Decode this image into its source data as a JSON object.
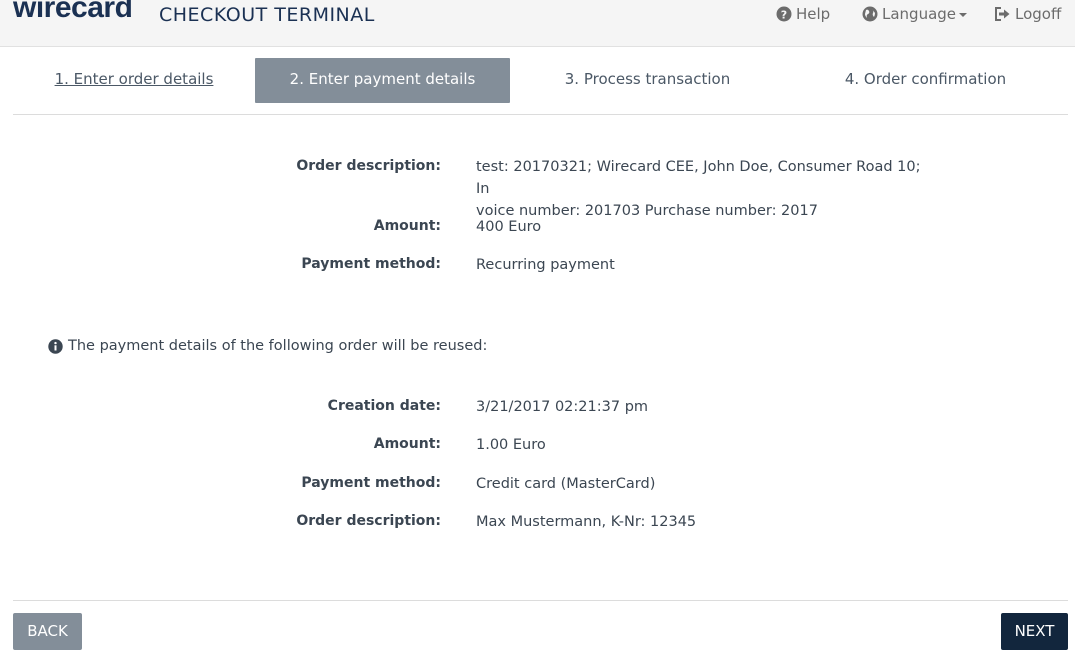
{
  "header": {
    "logo_text": "wirecard",
    "app_title": "CHECKOUT TERMINAL",
    "help_label": "Help",
    "language_label": "Language",
    "logoff_label": "Logoff"
  },
  "steps": [
    {
      "label": "1. Enter order details",
      "state": "link"
    },
    {
      "label": "2. Enter payment details",
      "state": "active"
    },
    {
      "label": "3. Process transaction",
      "state": "pending"
    },
    {
      "label": "4. Order confirmation",
      "state": "pending"
    }
  ],
  "order": {
    "description_label": "Order description:",
    "description_line1": "test: 20170321; Wirecard CEE, John Doe, Consumer Road 10; In",
    "description_line2": "voice number: 201703 Purchase number: 2017",
    "amount_label": "Amount:",
    "amount_value": "400 Euro",
    "method_label": "Payment method:",
    "method_value": "Recurring payment"
  },
  "info_text": "The payment details of the following order will be reused:",
  "reused": {
    "date_label": "Creation date:",
    "date_value": "3/21/2017 02:21:37 pm",
    "amount_label": "Amount:",
    "amount_value": "1.00 Euro",
    "method_label": "Payment method:",
    "method_value": "Credit card (MasterCard)",
    "description_label": "Order description:",
    "description_value": "Max Mustermann, K-Nr: 12345"
  },
  "buttons": {
    "back_label": "BACK",
    "next_label": "NEXT"
  },
  "colors": {
    "brand": "#1b3153",
    "active_step": "#838e99",
    "next_button": "#12263d",
    "text": "#3b4652"
  },
  "icons": {
    "help": "question-circle-icon",
    "language": "globe-icon",
    "logoff": "logoff-icon",
    "info": "info-circle-icon"
  }
}
